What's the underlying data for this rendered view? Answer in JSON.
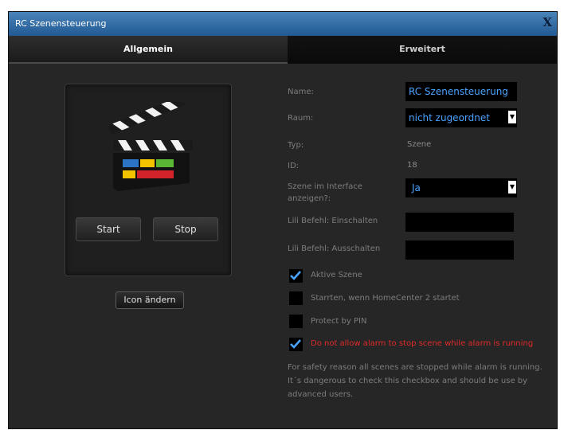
{
  "window": {
    "title": "RC Szenensteuerung",
    "close_label": "X"
  },
  "tabs": [
    {
      "label": "Allgemein",
      "active": true
    },
    {
      "label": "Erweitert",
      "active": false
    }
  ],
  "left_panel": {
    "icon": "clapperboard-icon",
    "start_label": "Start",
    "stop_label": "Stop",
    "change_icon_label": "Icon ändern"
  },
  "form": {
    "name": {
      "label": "Name:",
      "value": "RC Szenensteuerung"
    },
    "room": {
      "label": "Raum:",
      "value": "nicht zugeordnet"
    },
    "type": {
      "label": "Typ:",
      "value": "Szene"
    },
    "id": {
      "label": "ID:",
      "value": "18"
    },
    "show_in_interface": {
      "label_line1": "Szene im Interface",
      "label_line2": "anzeigen?:",
      "value": "Ja"
    },
    "lili_on": {
      "label": "Lili Befehl: Einschalten",
      "value": ""
    },
    "lili_off": {
      "label": "Lili Befehl: Ausschalten",
      "value": ""
    }
  },
  "checkboxes": [
    {
      "label": "Aktive Szene",
      "checked": true
    },
    {
      "label": "Starrten, wenn HomeCenter 2 startet",
      "checked": false
    },
    {
      "label": "Protect by PIN",
      "checked": false
    },
    {
      "label": "Do not allow alarm to stop scene while alarm is running",
      "checked": true
    }
  ],
  "note": {
    "line1": "For safety reason all scenes are stopped while alarm is running.",
    "line2": "It´s dangerous to check this checkbox and should be use by",
    "line3": "advanced users."
  },
  "colors": {
    "accent": "#4aa3ff",
    "warning": "#e02a2a",
    "titlebar": "#2f6aa6",
    "background": "#262626"
  }
}
